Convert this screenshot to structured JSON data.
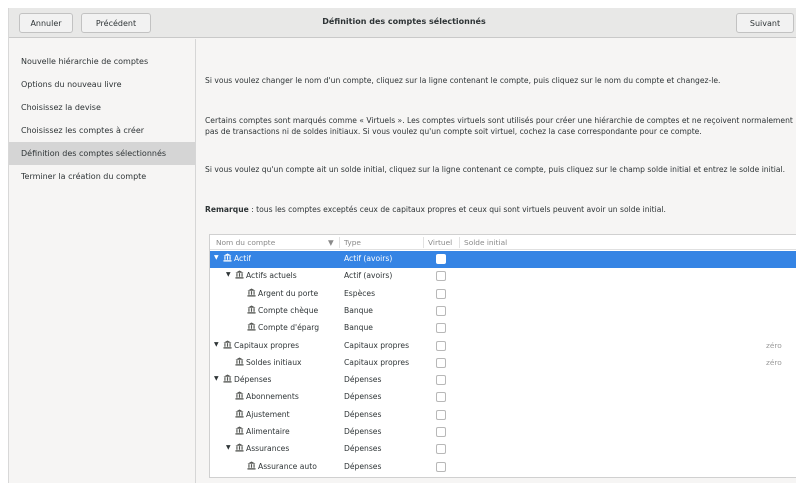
{
  "header": {
    "cancel_label": "Annuler",
    "previous_label": "Précédent",
    "title": "Définition des comptes sélectionnés",
    "next_label": "Suivant"
  },
  "sidebar": {
    "items": [
      {
        "label": "Nouvelle hiérarchie de comptes"
      },
      {
        "label": "Options du nouveau livre"
      },
      {
        "label": "Choisissez la devise"
      },
      {
        "label": "Choisissez les comptes à créer"
      },
      {
        "label": "Définition des comptes sélectionnés"
      },
      {
        "label": "Terminer la création du compte"
      }
    ]
  },
  "main": {
    "para1": "Si vous voulez changer le nom d'un compte, cliquez sur la ligne contenant le compte, puis cliquez sur le nom du compte et changez-le.",
    "para2": "Certains comptes sont marqués comme « Virtuels ». Les comptes virtuels sont utilisés pour créer une hiérarchie de comptes et ne reçoivent normalement pas de transactions ni de soldes initiaux. Si vous voulez qu'un compte soit virtuel, cochez la case correspondante pour ce compte.",
    "para3": "Si vous voulez qu'un compte ait un solde initial, cliquez sur la ligne contenant ce compte, puis cliquez sur le champ solde initial et entrez le solde initial.",
    "note_label": "Remarque",
    "note_text": " : tous les comptes exceptés ceux de capitaux propres et ceux qui sont virtuels peuvent avoir un solde initial."
  },
  "tree": {
    "columns": {
      "name": "Nom du compte",
      "sort_indicator": "▼",
      "type": "Type",
      "virtual": "Virtuel",
      "solde": "Solde initial"
    },
    "rows": [
      {
        "name": "Actif",
        "type": "Actif (avoirs)",
        "level": 0,
        "expander": "▼",
        "selected": true,
        "virtual": false,
        "solde": ""
      },
      {
        "name": "Actifs actuels",
        "type": "Actif (avoirs)",
        "level": 1,
        "expander": "▼",
        "selected": false,
        "virtual": false,
        "solde": ""
      },
      {
        "name": "Argent du porte",
        "type": "Espèces",
        "level": 2,
        "expander": "",
        "selected": false,
        "virtual": false,
        "solde": ""
      },
      {
        "name": "Compte chèque",
        "type": "Banque",
        "level": 2,
        "expander": "",
        "selected": false,
        "virtual": false,
        "solde": ""
      },
      {
        "name": "Compte d'éparg",
        "type": "Banque",
        "level": 2,
        "expander": "",
        "selected": false,
        "virtual": false,
        "solde": ""
      },
      {
        "name": "Capitaux propres",
        "type": "Capitaux propres",
        "level": 0,
        "expander": "▼",
        "selected": false,
        "virtual": false,
        "solde": "zéro"
      },
      {
        "name": "Soldes initiaux",
        "type": "Capitaux propres",
        "level": 1,
        "expander": "",
        "selected": false,
        "virtual": false,
        "solde": "zéro"
      },
      {
        "name": "Dépenses",
        "type": "Dépenses",
        "level": 0,
        "expander": "▼",
        "selected": false,
        "virtual": false,
        "solde": ""
      },
      {
        "name": "Abonnements",
        "type": "Dépenses",
        "level": 1,
        "expander": "",
        "selected": false,
        "virtual": false,
        "solde": ""
      },
      {
        "name": "Ajustement",
        "type": "Dépenses",
        "level": 1,
        "expander": "",
        "selected": false,
        "virtual": false,
        "solde": ""
      },
      {
        "name": "Alimentaire",
        "type": "Dépenses",
        "level": 1,
        "expander": "",
        "selected": false,
        "virtual": false,
        "solde": ""
      },
      {
        "name": "Assurances",
        "type": "Dépenses",
        "level": 1,
        "expander": "▼",
        "selected": false,
        "virtual": false,
        "solde": ""
      },
      {
        "name": "Assurance auto",
        "type": "Dépenses",
        "level": 2,
        "expander": "",
        "selected": false,
        "virtual": false,
        "solde": ""
      }
    ]
  },
  "colors": {
    "selection": "#3584e4",
    "header_bg": "#e8e8e7",
    "sidebar_active": "#d5d5d5"
  },
  "icons": {
    "account": "account-icon",
    "expander": "expander-arrow-icon"
  }
}
